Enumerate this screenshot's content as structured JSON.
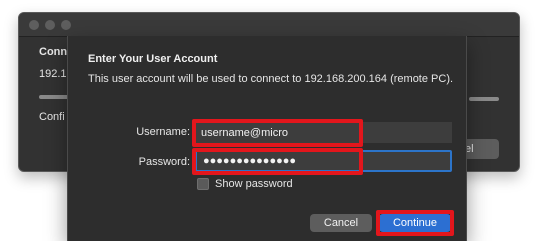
{
  "background_window": {
    "title_prefix": "Conn",
    "ip_prefix": "192.1",
    "conf_prefix": "Confi",
    "cancel_fragment": "el"
  },
  "dialog": {
    "title": "Enter Your User Account",
    "description": "This user account will be used to connect to 192.168.200.164 (remote PC).",
    "username_label": "Username:",
    "username_value": "username@micro",
    "password_label": "Password:",
    "password_value": "●●●●●●●●●●●●●●",
    "show_password_label": "Show password",
    "cancel_label": "Cancel",
    "continue_label": "Continue"
  },
  "colors": {
    "accent": "#2c6fd2",
    "highlight": "#e3161c",
    "dialog_bg": "#2d2d2d"
  },
  "icons": {
    "window_controls": [
      "close-icon",
      "minimize-icon",
      "zoom-icon"
    ]
  }
}
